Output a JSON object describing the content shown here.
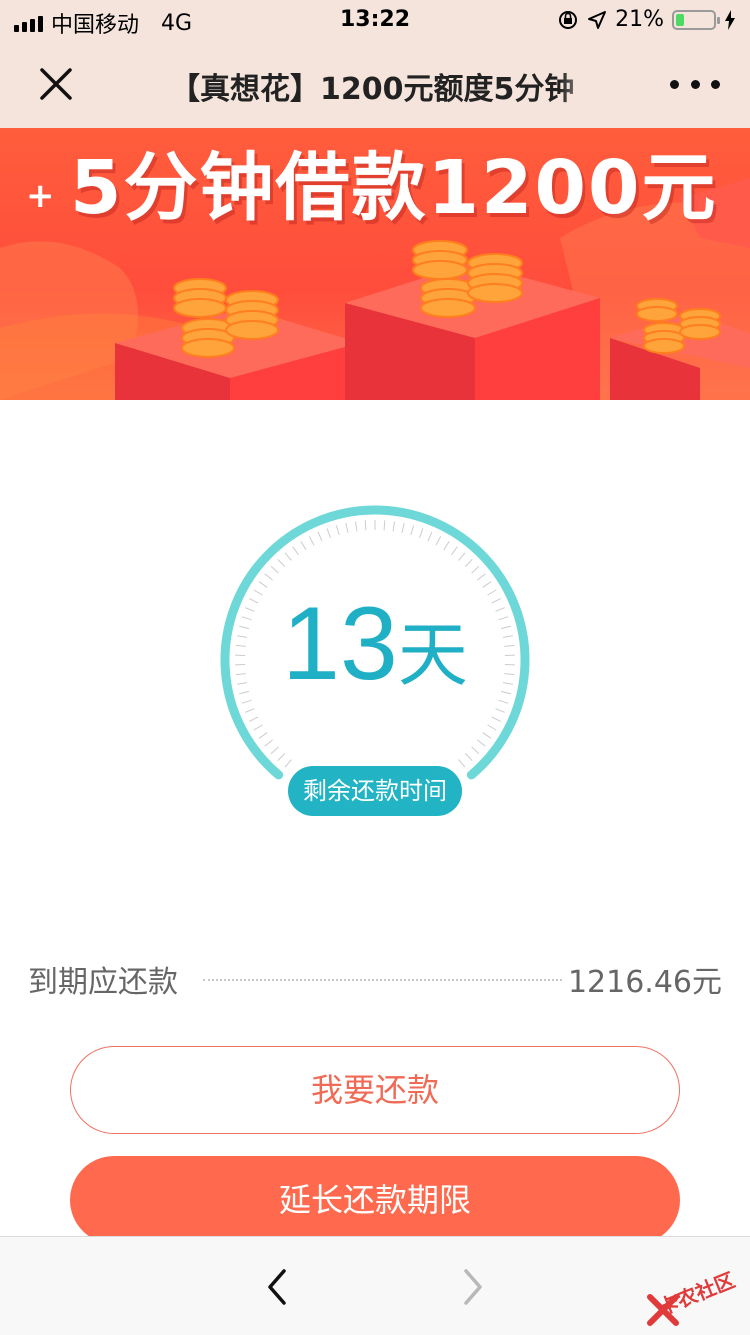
{
  "status_bar": {
    "carrier": "中国移动",
    "network": "4G",
    "time": "13:22",
    "battery_percent": "21%",
    "battery_level": 0.21,
    "battery_color": "#4cd964"
  },
  "nav": {
    "title": "【真想花】1200元额度5分钟",
    "close_icon": "close-icon",
    "more_icon": "more-icon"
  },
  "banner": {
    "headline": "5分钟借款1200元",
    "plus": "+"
  },
  "countdown": {
    "days": "13",
    "unit": "天",
    "label": "剩余还款时间",
    "accent_color": "#22b4c4"
  },
  "due": {
    "label": "到期应还款",
    "amount": "1216.46元"
  },
  "actions": {
    "repay_label": "我要还款",
    "extend_label": "延长还款期限",
    "primary_color": "#ff6a4e"
  },
  "watermark": {
    "text": "卡农社区"
  }
}
